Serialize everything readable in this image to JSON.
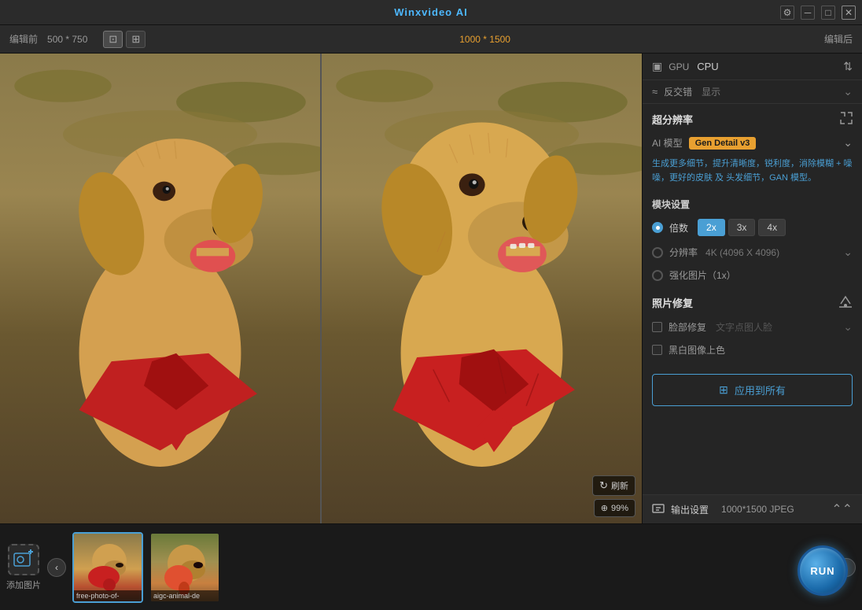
{
  "titlebar": {
    "title": "Winxvideo",
    "ai_label": "AI",
    "settings_icon": "⚙",
    "minimize_icon": "─",
    "maximize_icon": "□",
    "close_icon": "✕"
  },
  "toolbar": {
    "before_label": "编辑前",
    "size_label": "500 * 750",
    "center_size": "1000 * 1500",
    "after_label": "编辑后"
  },
  "right_panel": {
    "gpu_label": "GPU",
    "cpu_label": "CPU",
    "antialias_label": "反交错",
    "antialias_value": "显示",
    "super_res_title": "超分辨率",
    "ai_model_label": "AI 模型",
    "ai_model_value": "Gen Detail v3",
    "description": "生成更多细节，提升清晰度，锐利度，消除模糊 + 噪噪，更好的皮肤 及 头发细节，GAN 模型。",
    "module_settings": "模块设置",
    "multiplier_label": "倍数",
    "mult_2x": "2x",
    "mult_3x": "3x",
    "mult_4x": "4x",
    "resolution_label": "分辨率",
    "resolution_value": "4K (4096 X 4096)",
    "enhance_label": "强化图片（1x）",
    "photo_repair_title": "照片修复",
    "face_repair_label": "脸部修复",
    "face_repair_value": "文字点图人脸",
    "bw_colorize_label": "黑白图像上色",
    "apply_all_label": "应用到所有",
    "output_settings_label": "输出设置",
    "output_value": "1000*1500  JPEG"
  },
  "image_overlay": {
    "refresh_label": "刷新",
    "zoom_label": "99%"
  },
  "filmstrip": {
    "add_label": "添加图片",
    "thumb1_label": "free-photo-of-",
    "thumb2_label": "aigc-animal-de"
  },
  "run_btn": {
    "label": "RUN"
  }
}
